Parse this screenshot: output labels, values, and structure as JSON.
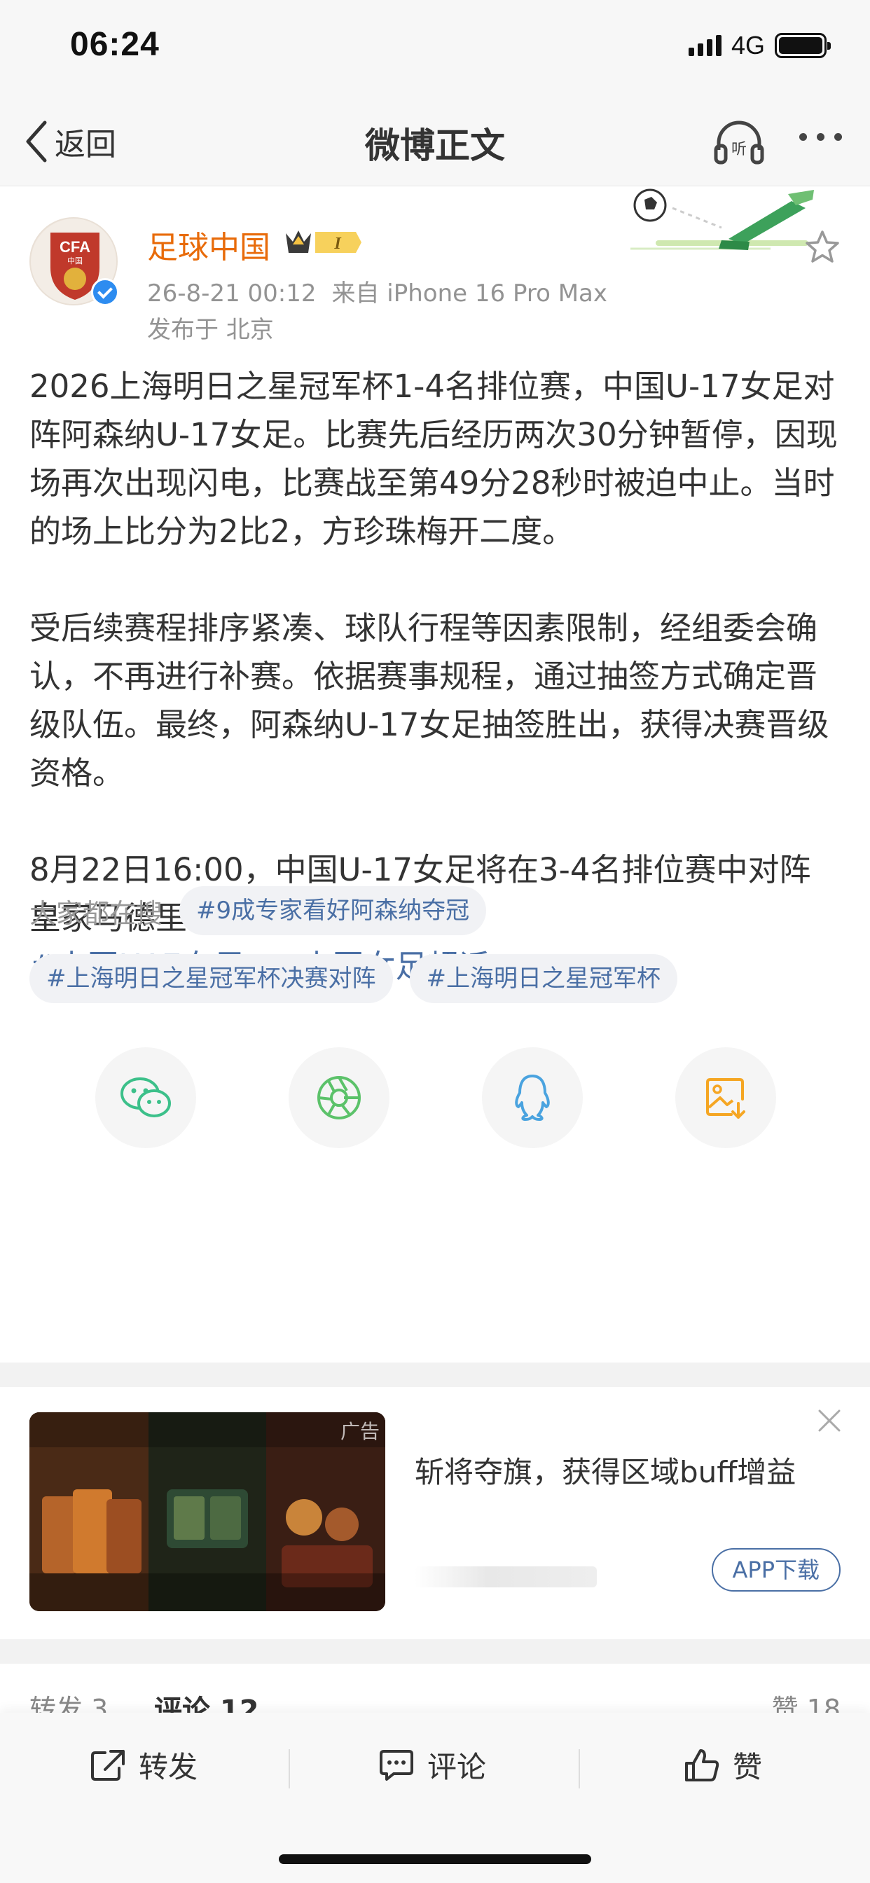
{
  "status_bar": {
    "time": "06:24",
    "network": "4G"
  },
  "nav": {
    "back_label": "返回",
    "title": "微博正文"
  },
  "post": {
    "author": "足球中国",
    "meta_time": "26-8-21 00:12",
    "meta_source": "来自 iPhone 16 Pro Max",
    "location": "发布于 北京",
    "paragraph1": "2026上海明日之星冠军杯1-4名排位赛，中国U-17女足对阵阿森纳U-17女足。比赛先后经历两次30分钟暂停，因现场再次出现闪电，比赛战至第49分28秒时被迫中止。当时的场上比分为2比2，方珍珠梅开二度。",
    "paragraph2": "受后续赛程排序紧凑、球队行程等因素限制，经组委会确认，不再进行补赛。依据赛事规程，通过抽签方式确定晋级队伍。最终，阿森纳U-17女足抽签胜出，获得决赛晋级资格。",
    "paragraph3": "8月22日16:00，中国U-17女足将在3-4名排位赛中对阵皇家马德里U-17女足。",
    "hashtag1": "#中国U17女足#",
    "hashtag2": "中国女足超话"
  },
  "trending": {
    "label": "大家都在搜",
    "items": [
      "#9成专家看好阿森纳夺冠",
      "#上海明日之星冠军杯决赛对阵",
      "#上海明日之星冠军杯"
    ]
  },
  "share": {
    "icons": [
      "wechat-icon",
      "moments-icon",
      "qq-icon",
      "save-image-icon"
    ]
  },
  "ad": {
    "tag": "广告",
    "text": "斩将夺旗，获得区域buff增益",
    "button": "APP下载"
  },
  "counts": {
    "repost": "转发 3",
    "comment": "评论 12",
    "like": "赞 18"
  },
  "bottom_bar": {
    "repost": "转发",
    "comment": "评论",
    "like": "赞"
  },
  "colors": {
    "author": "#e86b0a",
    "link": "#4a6fa5",
    "meta": "#939393",
    "wechat": "#3cc08a",
    "moments": "#5cc26a",
    "qq": "#4aa3df",
    "save": "#f5a623"
  }
}
